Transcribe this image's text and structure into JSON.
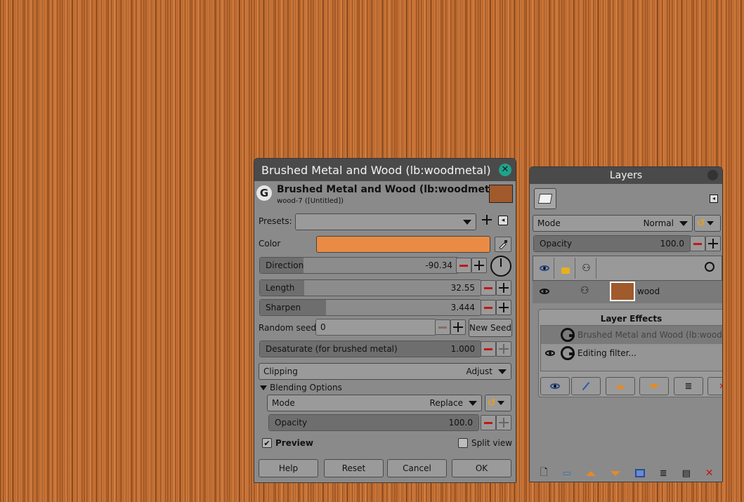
{
  "dialog": {
    "window_title": "Brushed Metal and Wood (lb:woodmetal)",
    "header_title": "Brushed Metal and Wood (lb:woodmetal)",
    "header_subtitle": "wood-7 ([Untitled])",
    "header_swatch_color": "#a05a2c",
    "presets_label": "Presets:",
    "presets_value": "",
    "color_label": "Color",
    "color_value": "#e98b45",
    "direction": {
      "label": "Direction",
      "value": "-90.34",
      "fill": 0.22
    },
    "length": {
      "label": "Length",
      "value": "32.55",
      "fill": 0.2
    },
    "sharpen": {
      "label": "Sharpen",
      "value": "3.444",
      "fill": 0.3
    },
    "random_seed": {
      "label": "Random seed",
      "value": "0",
      "new_seed_label": "New Seed"
    },
    "desaturate": {
      "label": "Desaturate (for brushed metal)",
      "value": "1.000",
      "fill": 1.0
    },
    "clipping": {
      "label": "Clipping",
      "value": "Adjust"
    },
    "blending": {
      "section_label": "Blending Options",
      "mode_label": "Mode",
      "mode_value": "Replace",
      "opacity_label": "Opacity",
      "opacity_value": "100.0",
      "opacity_fill": 1.0
    },
    "preview_label": "Preview",
    "preview_checked": true,
    "split_view_label": "Split view",
    "split_view_checked": false,
    "buttons": {
      "help": "Help",
      "reset": "Reset",
      "cancel": "Cancel",
      "ok": "OK"
    }
  },
  "layers": {
    "window_title": "Layers",
    "mode_label": "Mode",
    "mode_value": "Normal",
    "opacity_label": "Opacity",
    "opacity_value": "100.0",
    "opacity_fill": 1.0,
    "layer_name": "wood",
    "layer_swatch_color": "#a05a2c",
    "effects_title": "Layer Effects",
    "effects": [
      {
        "name": "Brushed Metal and Wood (lb:woodme",
        "visible": false
      },
      {
        "name": "Editing filter...",
        "visible": true
      }
    ]
  }
}
